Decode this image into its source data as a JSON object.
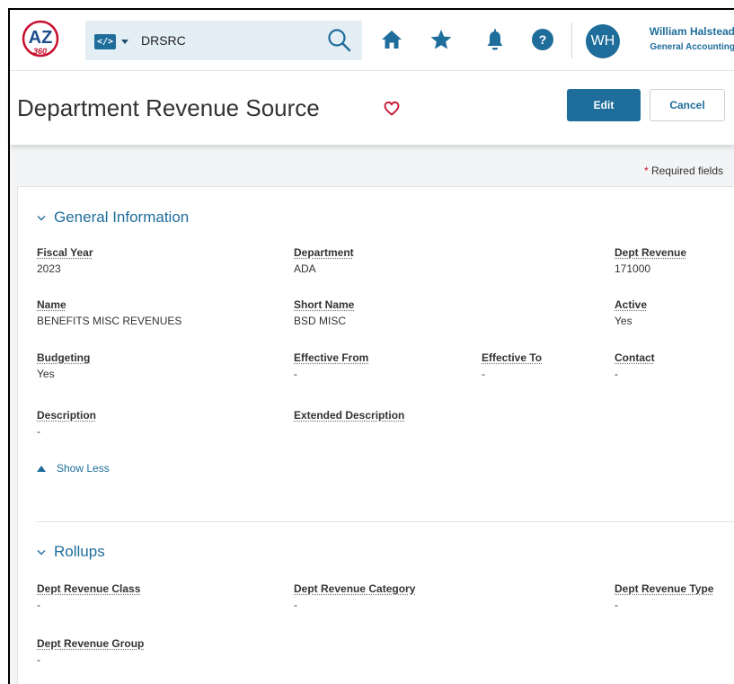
{
  "header": {
    "logo_text": "AZ 360",
    "command": {
      "code_icon": "code-icon",
      "value": "DRSRC"
    },
    "icons": [
      "search-icon",
      "home-icon",
      "star-icon",
      "bell-icon",
      "help-icon"
    ],
    "help_glyph": "?",
    "user": {
      "initials": "WH",
      "name": "William Halstead",
      "department": "General Accounting"
    },
    "colors": {
      "brand": "#1f6d9b",
      "logo_red": "#c8102e",
      "command_bg": "#e4eef5"
    }
  },
  "title_bar": {
    "title": "Department Revenue Source",
    "edit_label": "Edit",
    "cancel_label": "Cancel"
  },
  "required_note": {
    "star": "*",
    "text": "Required fields"
  },
  "general": {
    "title": "General Information",
    "fiscal_year": {
      "label": "Fiscal Year",
      "value": "2023"
    },
    "department": {
      "label": "Department",
      "value": "ADA"
    },
    "dept_revenue": {
      "label": "Dept Revenue",
      "value": "171000"
    },
    "name": {
      "label": "Name",
      "value": "BENEFITS MISC REVENUES"
    },
    "short_name": {
      "label": "Short Name",
      "value": "BSD MISC"
    },
    "active": {
      "label": "Active",
      "value": "Yes"
    },
    "budgeting": {
      "label": "Budgeting",
      "value": "Yes"
    },
    "effective_from": {
      "label": "Effective From",
      "value": "-"
    },
    "effective_to": {
      "label": "Effective To",
      "value": "-"
    },
    "contact": {
      "label": "Contact",
      "value": "-"
    },
    "description": {
      "label": "Description",
      "value": "-"
    },
    "extended_description": {
      "label": "Extended Description",
      "value": ""
    },
    "show_less": "Show Less"
  },
  "rollups": {
    "title": "Rollups",
    "dept_revenue_class": {
      "label": "Dept Revenue Class",
      "value": "-"
    },
    "dept_revenue_category": {
      "label": "Dept Revenue Category",
      "value": "-"
    },
    "dept_revenue_type": {
      "label": "Dept Revenue Type",
      "value": "-"
    },
    "dept_revenue_group": {
      "label": "Dept Revenue Group",
      "value": "-"
    }
  }
}
